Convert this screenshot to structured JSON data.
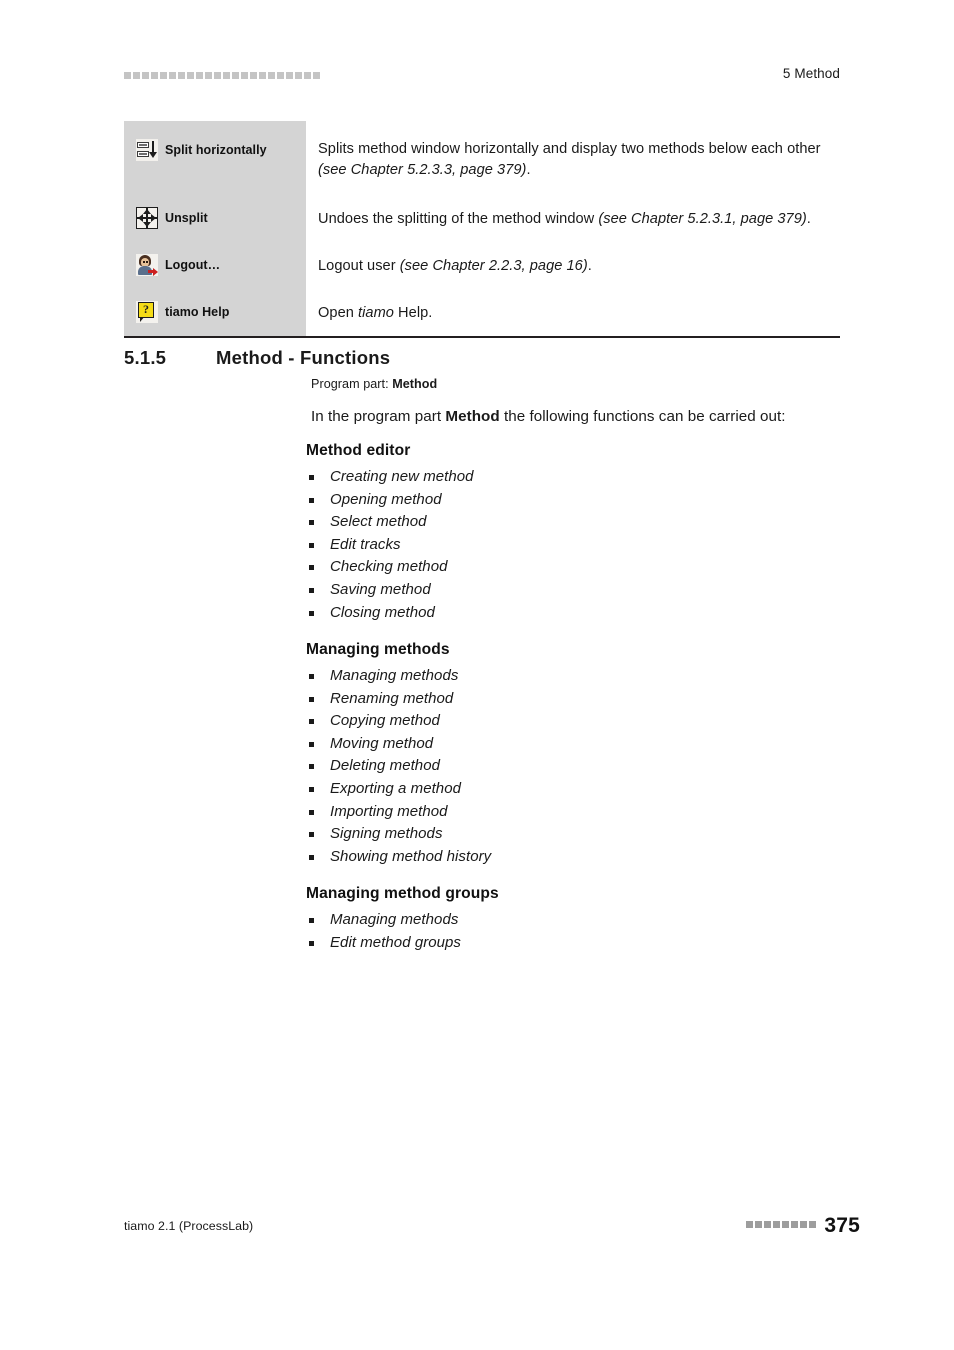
{
  "header": {
    "decor_dots_count": 22,
    "title": "5 Method"
  },
  "function_table": {
    "rows": [
      {
        "icon": "split-horizontally-icon",
        "label": "Split horizontally",
        "description_plain": "Splits method window horizontally and display two methods below each other",
        "description_italic": "(see Chapter 5.2.3.3, page 379)",
        "description_tail": "."
      },
      {
        "icon": "unsplit-icon",
        "label": "Unsplit",
        "description_plain": "Undoes the splitting of the method window ",
        "description_italic": "(see Chapter 5.2.3.1, page 379)",
        "description_tail": "."
      },
      {
        "icon": "logout-icon",
        "label": "Logout…",
        "description_plain": "Logout user ",
        "description_italic": "(see Chapter 2.2.3, page 16)",
        "description_tail": "."
      },
      {
        "icon": "tiamo-help-icon",
        "label": "tiamo Help",
        "description_plain": "Open ",
        "description_italic": "tiamo",
        "description_tail": " Help."
      }
    ]
  },
  "section": {
    "number": "5.1.5",
    "title": "Method - Functions",
    "program_part_label": "Program part:",
    "program_part_value": "Method",
    "intro_before": "In the program part ",
    "intro_bold": "Method",
    "intro_after": " the following functions can be carried out:"
  },
  "groups": [
    {
      "title": "Method editor",
      "items": [
        "Creating new method",
        "Opening method",
        "Select method",
        "Edit tracks",
        "Checking method",
        "Saving method",
        "Closing method"
      ]
    },
    {
      "title": "Managing methods",
      "items": [
        "Managing methods",
        "Renaming method",
        "Copying method",
        "Moving method",
        "Deleting method",
        "Exporting a method",
        "Importing method",
        "Signing methods",
        "Showing method history"
      ]
    },
    {
      "title": "Managing method groups",
      "items": [
        "Managing methods",
        "Edit method groups"
      ]
    }
  ],
  "footer": {
    "product": "tiamo 2.1 (ProcessLab)",
    "decor_dots_count": 8,
    "page_number": "375"
  },
  "colors": {
    "table_label_bg": "#d4d4d4",
    "table_rule": "#231f20",
    "header_dot": "#c4c4c4",
    "footer_dot": "#9d9d9d",
    "help_yellow": "#f5dc17",
    "logout_red": "#cc1f1f",
    "text": "#1a1a1a"
  }
}
